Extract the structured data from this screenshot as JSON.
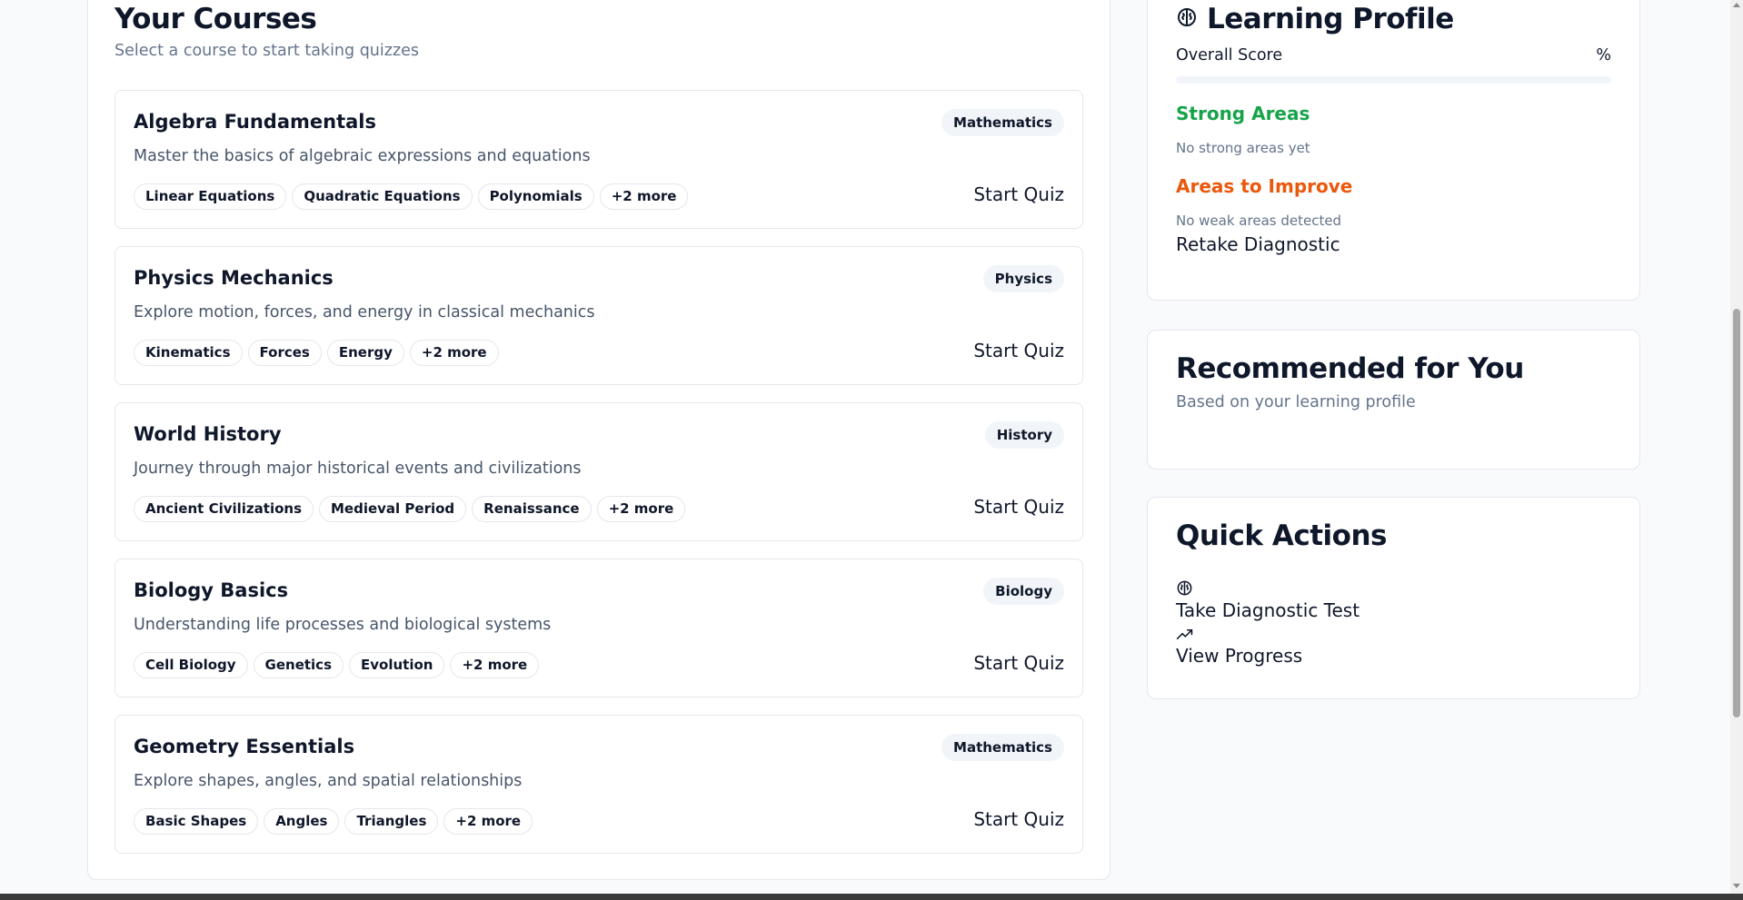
{
  "courses_section": {
    "title": "Your Courses",
    "subtitle": "Select a course to start taking quizzes",
    "courses": [
      {
        "title": "Algebra Fundamentals",
        "subject": "Mathematics",
        "description": "Master the basics of algebraic expressions and equations",
        "topics": [
          "Linear Equations",
          "Quadratic Equations",
          "Polynomials",
          "+2 more"
        ],
        "action": "Start Quiz"
      },
      {
        "title": "Physics Mechanics",
        "subject": "Physics",
        "description": "Explore motion, forces, and energy in classical mechanics",
        "topics": [
          "Kinematics",
          "Forces",
          "Energy",
          "+2 more"
        ],
        "action": "Start Quiz"
      },
      {
        "title": "World History",
        "subject": "History",
        "description": "Journey through major historical events and civilizations",
        "topics": [
          "Ancient Civilizations",
          "Medieval Period",
          "Renaissance",
          "+2 more"
        ],
        "action": "Start Quiz"
      },
      {
        "title": "Biology Basics",
        "subject": "Biology",
        "description": "Understanding life processes and biological systems",
        "topics": [
          "Cell Biology",
          "Genetics",
          "Evolution",
          "+2 more"
        ],
        "action": "Start Quiz"
      },
      {
        "title": "Geometry Essentials",
        "subject": "Mathematics",
        "description": "Explore shapes, angles, and spatial relationships",
        "topics": [
          "Basic Shapes",
          "Angles",
          "Triangles",
          "+2 more"
        ],
        "action": "Start Quiz"
      }
    ]
  },
  "learning_profile": {
    "icon": "brain-icon",
    "title": "Learning Profile",
    "score_label": "Overall Score",
    "score_value": "%",
    "score_progress": 0,
    "strong_title": "Strong Areas",
    "strong_note": "No strong areas yet",
    "improve_title": "Areas to Improve",
    "improve_note": "No weak areas detected",
    "retake_label": "Retake Diagnostic"
  },
  "recommended": {
    "title": "Recommended for You",
    "subtitle": "Based on your learning profile"
  },
  "quick_actions": {
    "title": "Quick Actions",
    "items": [
      {
        "icon": "brain-icon",
        "label": "Take Diagnostic Test"
      },
      {
        "icon": "trending-up-icon",
        "label": "View Progress"
      }
    ]
  },
  "colors": {
    "strong": "#16a34a",
    "improve": "#ea580c",
    "text": "#0f172a",
    "muted": "#64748b"
  }
}
